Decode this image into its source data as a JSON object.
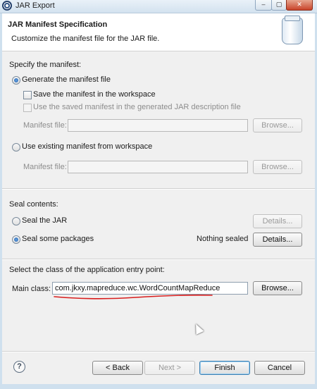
{
  "window": {
    "title": "JAR Export"
  },
  "header": {
    "title": "JAR Manifest Specification",
    "description": "Customize the manifest file for the JAR file."
  },
  "manifest": {
    "section_label": "Specify the manifest:",
    "generate_label": "Generate the manifest file",
    "save_label": "Save the manifest in the workspace",
    "use_saved_label": "Use the saved manifest in the generated JAR description file",
    "manifest_file_label": "Manifest file:",
    "browse_label": "Browse...",
    "existing_label": "Use existing manifest from workspace",
    "existing_file_label": "Manifest file:",
    "existing_browse_label": "Browse..."
  },
  "seal": {
    "section_label": "Seal contents:",
    "seal_jar_label": "Seal the JAR",
    "details_label": "Details...",
    "seal_packages_label": "Seal some packages",
    "status": "Nothing sealed",
    "packages_details_label": "Details..."
  },
  "entry": {
    "section_label": "Select the class of the application entry point:",
    "main_class_label": "Main class:",
    "main_class_value": "com.jkxy.mapreduce.wc.WordCountMapReduce",
    "browse_label": "Browse..."
  },
  "footer": {
    "back_label": "< Back",
    "next_label": "Next >",
    "finish_label": "Finish",
    "cancel_label": "Cancel"
  },
  "state": {
    "generate_selected": true,
    "seal_packages_selected": true
  },
  "colors": {
    "annotation_underline": "#d81e1e",
    "default_button_border": "#3c7fb1"
  }
}
